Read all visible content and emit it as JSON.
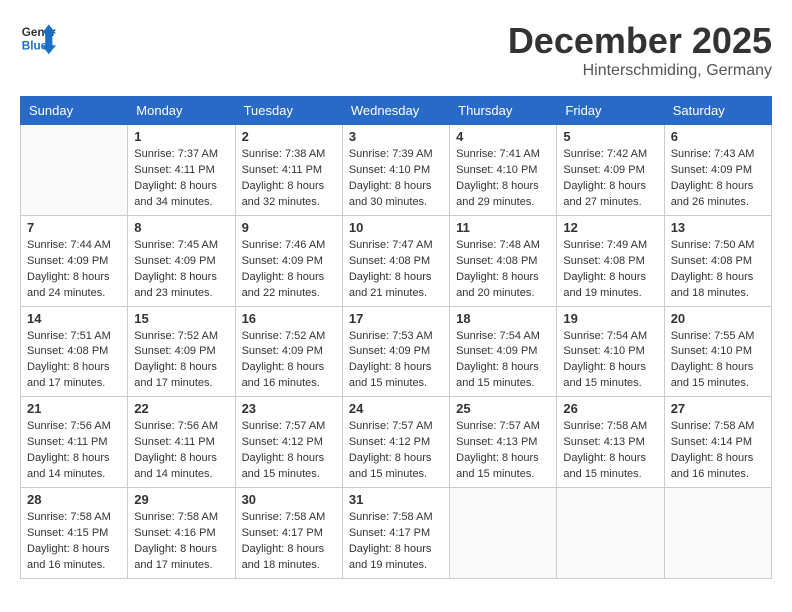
{
  "logo": {
    "line1": "General",
    "line2": "Blue"
  },
  "title": "December 2025",
  "subtitle": "Hinterschmiding, Germany",
  "weekdays": [
    "Sunday",
    "Monday",
    "Tuesday",
    "Wednesday",
    "Thursday",
    "Friday",
    "Saturday"
  ],
  "weeks": [
    [
      {
        "day": "",
        "info": ""
      },
      {
        "day": "1",
        "info": "Sunrise: 7:37 AM\nSunset: 4:11 PM\nDaylight: 8 hours\nand 34 minutes."
      },
      {
        "day": "2",
        "info": "Sunrise: 7:38 AM\nSunset: 4:11 PM\nDaylight: 8 hours\nand 32 minutes."
      },
      {
        "day": "3",
        "info": "Sunrise: 7:39 AM\nSunset: 4:10 PM\nDaylight: 8 hours\nand 30 minutes."
      },
      {
        "day": "4",
        "info": "Sunrise: 7:41 AM\nSunset: 4:10 PM\nDaylight: 8 hours\nand 29 minutes."
      },
      {
        "day": "5",
        "info": "Sunrise: 7:42 AM\nSunset: 4:09 PM\nDaylight: 8 hours\nand 27 minutes."
      },
      {
        "day": "6",
        "info": "Sunrise: 7:43 AM\nSunset: 4:09 PM\nDaylight: 8 hours\nand 26 minutes."
      }
    ],
    [
      {
        "day": "7",
        "info": "Sunrise: 7:44 AM\nSunset: 4:09 PM\nDaylight: 8 hours\nand 24 minutes."
      },
      {
        "day": "8",
        "info": "Sunrise: 7:45 AM\nSunset: 4:09 PM\nDaylight: 8 hours\nand 23 minutes."
      },
      {
        "day": "9",
        "info": "Sunrise: 7:46 AM\nSunset: 4:09 PM\nDaylight: 8 hours\nand 22 minutes."
      },
      {
        "day": "10",
        "info": "Sunrise: 7:47 AM\nSunset: 4:08 PM\nDaylight: 8 hours\nand 21 minutes."
      },
      {
        "day": "11",
        "info": "Sunrise: 7:48 AM\nSunset: 4:08 PM\nDaylight: 8 hours\nand 20 minutes."
      },
      {
        "day": "12",
        "info": "Sunrise: 7:49 AM\nSunset: 4:08 PM\nDaylight: 8 hours\nand 19 minutes."
      },
      {
        "day": "13",
        "info": "Sunrise: 7:50 AM\nSunset: 4:08 PM\nDaylight: 8 hours\nand 18 minutes."
      }
    ],
    [
      {
        "day": "14",
        "info": "Sunrise: 7:51 AM\nSunset: 4:08 PM\nDaylight: 8 hours\nand 17 minutes."
      },
      {
        "day": "15",
        "info": "Sunrise: 7:52 AM\nSunset: 4:09 PM\nDaylight: 8 hours\nand 17 minutes."
      },
      {
        "day": "16",
        "info": "Sunrise: 7:52 AM\nSunset: 4:09 PM\nDaylight: 8 hours\nand 16 minutes."
      },
      {
        "day": "17",
        "info": "Sunrise: 7:53 AM\nSunset: 4:09 PM\nDaylight: 8 hours\nand 15 minutes."
      },
      {
        "day": "18",
        "info": "Sunrise: 7:54 AM\nSunset: 4:09 PM\nDaylight: 8 hours\nand 15 minutes."
      },
      {
        "day": "19",
        "info": "Sunrise: 7:54 AM\nSunset: 4:10 PM\nDaylight: 8 hours\nand 15 minutes."
      },
      {
        "day": "20",
        "info": "Sunrise: 7:55 AM\nSunset: 4:10 PM\nDaylight: 8 hours\nand 15 minutes."
      }
    ],
    [
      {
        "day": "21",
        "info": "Sunrise: 7:56 AM\nSunset: 4:11 PM\nDaylight: 8 hours\nand 14 minutes."
      },
      {
        "day": "22",
        "info": "Sunrise: 7:56 AM\nSunset: 4:11 PM\nDaylight: 8 hours\nand 14 minutes."
      },
      {
        "day": "23",
        "info": "Sunrise: 7:57 AM\nSunset: 4:12 PM\nDaylight: 8 hours\nand 15 minutes."
      },
      {
        "day": "24",
        "info": "Sunrise: 7:57 AM\nSunset: 4:12 PM\nDaylight: 8 hours\nand 15 minutes."
      },
      {
        "day": "25",
        "info": "Sunrise: 7:57 AM\nSunset: 4:13 PM\nDaylight: 8 hours\nand 15 minutes."
      },
      {
        "day": "26",
        "info": "Sunrise: 7:58 AM\nSunset: 4:13 PM\nDaylight: 8 hours\nand 15 minutes."
      },
      {
        "day": "27",
        "info": "Sunrise: 7:58 AM\nSunset: 4:14 PM\nDaylight: 8 hours\nand 16 minutes."
      }
    ],
    [
      {
        "day": "28",
        "info": "Sunrise: 7:58 AM\nSunset: 4:15 PM\nDaylight: 8 hours\nand 16 minutes."
      },
      {
        "day": "29",
        "info": "Sunrise: 7:58 AM\nSunset: 4:16 PM\nDaylight: 8 hours\nand 17 minutes."
      },
      {
        "day": "30",
        "info": "Sunrise: 7:58 AM\nSunset: 4:17 PM\nDaylight: 8 hours\nand 18 minutes."
      },
      {
        "day": "31",
        "info": "Sunrise: 7:58 AM\nSunset: 4:17 PM\nDaylight: 8 hours\nand 19 minutes."
      },
      {
        "day": "",
        "info": ""
      },
      {
        "day": "",
        "info": ""
      },
      {
        "day": "",
        "info": ""
      }
    ]
  ]
}
